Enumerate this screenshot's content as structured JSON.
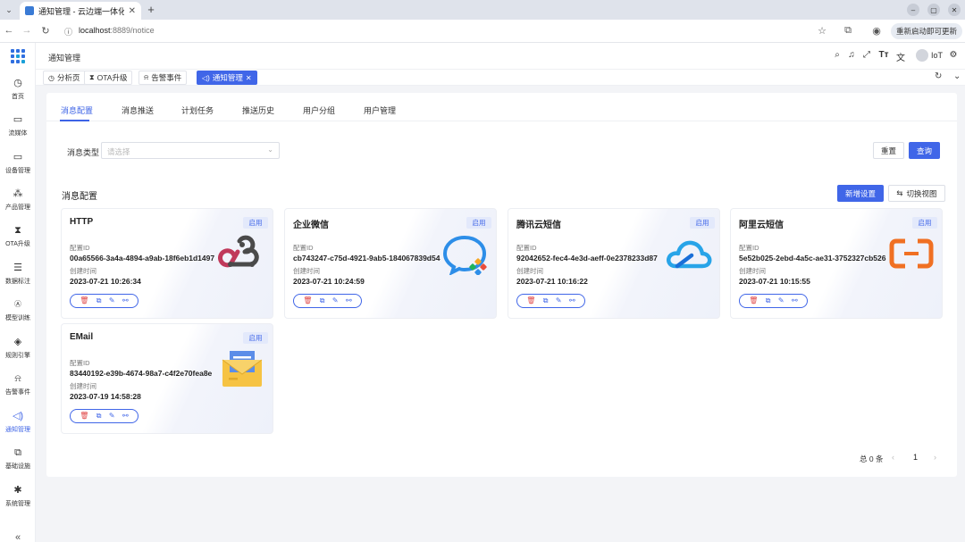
{
  "browser": {
    "tab_title": "通知管理 - 云边端一体化",
    "url_host": "localhost",
    "url_path": ":8889/notice",
    "update_label": "重新启动即可更新"
  },
  "app": {
    "breadcrumb": "通知管理",
    "user": "IoT"
  },
  "sidebar": {
    "items": [
      {
        "label": "首页",
        "icon": "dashboard-icon"
      },
      {
        "label": "流媒体",
        "icon": "video-icon"
      },
      {
        "label": "设备管理",
        "icon": "laptop-icon"
      },
      {
        "label": "产品管理",
        "icon": "cluster-icon"
      },
      {
        "label": "OTA升级",
        "icon": "hourglass-icon"
      },
      {
        "label": "数据标注",
        "icon": "database-icon"
      },
      {
        "label": "模型训练",
        "icon": "ai-icon"
      },
      {
        "label": "规则引擎",
        "icon": "aim-icon"
      },
      {
        "label": "告警事件",
        "icon": "alarm-icon"
      },
      {
        "label": "通知管理",
        "icon": "sound-icon"
      },
      {
        "label": "基础设施",
        "icon": "layers-icon"
      },
      {
        "label": "系统管理",
        "icon": "setting-icon"
      }
    ]
  },
  "page_tabs": [
    {
      "label": "分析页",
      "icon": "clock-icon"
    },
    {
      "label": "OTA升级",
      "icon": "hourglass-icon"
    },
    {
      "label": "告警事件",
      "icon": "alarm-icon"
    },
    {
      "label": "通知管理",
      "icon": "sound-icon"
    }
  ],
  "content_tabs": [
    "消息配置",
    "消息推送",
    "计划任务",
    "推送历史",
    "用户分组",
    "用户管理"
  ],
  "filter": {
    "label": "消息类型",
    "placeholder": "请选择",
    "reset_label": "重置",
    "query_label": "查询"
  },
  "section": {
    "title": "消息配置",
    "add_label": "新增设置",
    "switch_label": "切换视图"
  },
  "field_labels": {
    "config_id": "配置ID",
    "created": "创建时间"
  },
  "cards": [
    {
      "name": "HTTP",
      "badge": "启用",
      "config_id": "00a65566-3a4a-4894-a9ab-18f6eb1d1497",
      "created": "2023-07-21 10:26:34",
      "logo": "webhook-icon"
    },
    {
      "name": "企业微信",
      "badge": "启用",
      "config_id": "cb743247-c75d-4921-9ab5-184067839d54",
      "created": "2023-07-21 10:24:59",
      "logo": "wecom-icon"
    },
    {
      "name": "腾讯云短信",
      "badge": "启用",
      "config_id": "92042652-fec4-4e3d-aeff-0e2378233d87",
      "created": "2023-07-21 10:16:22",
      "logo": "tencent-cloud-icon"
    },
    {
      "name": "阿里云短信",
      "badge": "启用",
      "config_id": "5e52b025-2ebd-4a5c-ae31-3752327cb526",
      "created": "2023-07-21 10:15:55",
      "logo": "aliyun-icon"
    },
    {
      "name": "EMail",
      "badge": "启用",
      "config_id": "83440192-e39b-4674-98a7-c4f2e70fea8e",
      "created": "2023-07-19 14:58:28",
      "logo": "email-icon"
    }
  ],
  "pagination": {
    "total": "总 0 条",
    "page": "1"
  }
}
